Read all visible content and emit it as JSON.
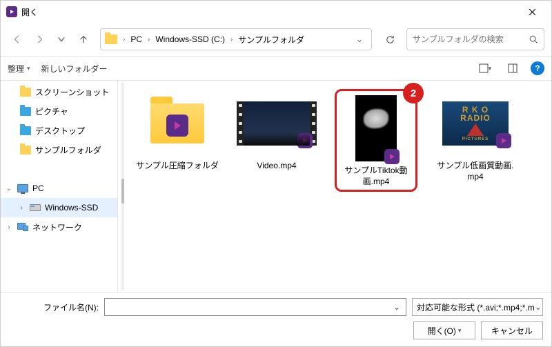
{
  "titlebar": {
    "title": "開く"
  },
  "breadcrumb": {
    "seg1": "PC",
    "seg2": "Windows-SSD (C:)",
    "seg3": "サンプルフォルダ"
  },
  "search": {
    "placeholder": "サンプルフォルダの検索"
  },
  "toolbar": {
    "organize": "整理",
    "new_folder": "新しいフォルダー"
  },
  "sidebar": {
    "items": [
      {
        "label": "スクリーンショット"
      },
      {
        "label": "ピクチャ"
      },
      {
        "label": "デスクトップ"
      },
      {
        "label": "サンプルフォルダ"
      },
      {
        "label": "PC"
      },
      {
        "label": "Windows-SSD"
      },
      {
        "label": "ネットワーク"
      }
    ]
  },
  "files": {
    "f0": "サンプル圧縮フォルダ",
    "f1": "Video.mp4",
    "f2": "サンプルTiktok動画.mp4",
    "f3": "サンプル低画質動画.mp4"
  },
  "annotation": {
    "badge": "2"
  },
  "footer": {
    "filename_label": "ファイル名(N):",
    "filter": "対応可能な形式 (*.avi;*.mp4;*.m",
    "open": "開く(O)",
    "cancel": "キャンセル"
  },
  "rko": {
    "l1": "R K O",
    "l2": "RADIO",
    "l3": "PICTURES"
  }
}
